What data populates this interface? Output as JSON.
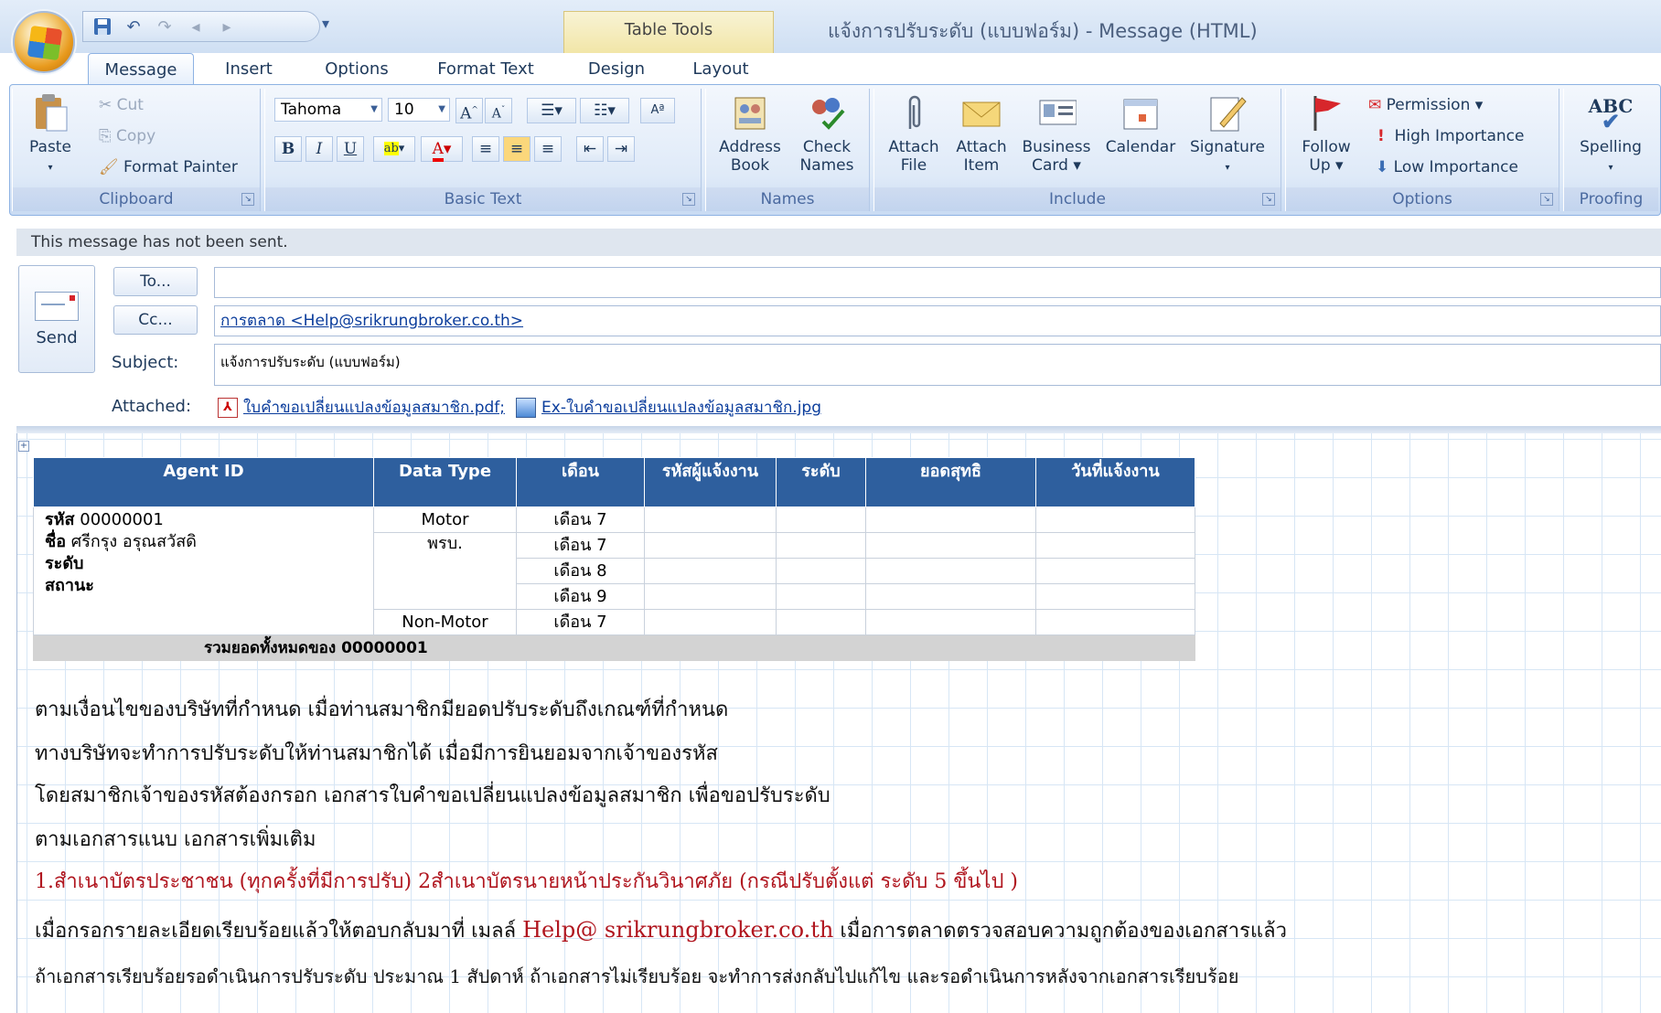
{
  "window": {
    "title": "แจ้งการปรับระดับ (แบบฟอร์ม) - Message (HTML)",
    "context_tab": "Table Tools"
  },
  "tabs": [
    "Message",
    "Insert",
    "Options",
    "Format Text",
    "Design",
    "Layout"
  ],
  "ribbon": {
    "clipboard": {
      "label": "Clipboard",
      "paste": "Paste",
      "cut": "Cut",
      "copy": "Copy",
      "format_painter": "Format Painter"
    },
    "basic_text": {
      "label": "Basic Text",
      "font": "Tahoma",
      "size": "10",
      "bold": "B",
      "italic": "I",
      "underline": "U"
    },
    "names": {
      "label": "Names",
      "address_book": [
        "Address",
        "Book"
      ],
      "check_names": [
        "Check",
        "Names"
      ]
    },
    "include": {
      "label": "Include",
      "attach_file": [
        "Attach",
        "File"
      ],
      "attach_item": [
        "Attach",
        "Item"
      ],
      "business_card": [
        "Business",
        "Card ▾"
      ],
      "calendar": "Calendar",
      "signature": "Signature"
    },
    "options": {
      "label": "Options",
      "follow_up": [
        "Follow",
        "Up ▾"
      ],
      "permission": "Permission ▾",
      "high": "High Importance",
      "low": "Low Importance"
    },
    "proofing": {
      "label": "Proofing",
      "spelling": "Spelling",
      "abc": "ABC"
    }
  },
  "message": {
    "notice": "This message has not been sent.",
    "send": "Send",
    "to_button": "To...",
    "cc_button": "Cc...",
    "to_value": "",
    "cc_value": "การตลาด <Help@srikrungbroker.co.th>",
    "subject_label": "Subject:",
    "subject_value": "แจ้งการปรับระดับ (แบบฟอร์ม)",
    "attached_label": "Attached:",
    "attachments": [
      "ใบคำขอเปลี่ยนแปลงข้อมูลสมาชิก.pdf;",
      "Ex-ใบคำขอเปลี่ยนแปลงข้อมูลสมาชิก.jpg"
    ]
  },
  "table": {
    "headers": [
      "Agent ID",
      "Data Type",
      "เดือน",
      "รหัสผู้แจ้งงาน",
      "ระดับ",
      "ยอดสุทธิ",
      "วันที่แจ้งงาน"
    ],
    "agent_lines": [
      {
        "label": "รหัส",
        "value": "00000001"
      },
      {
        "label": "ชื่อ",
        "value": "ศรีกรุง อรุณสวัสดิ"
      },
      {
        "label": "ระดับ",
        "value": ""
      },
      {
        "label": "สถานะ",
        "value": ""
      }
    ],
    "types": [
      "Motor",
      "พรบ.",
      "",
      "",
      "Non-Motor"
    ],
    "months": [
      "เดือน 7",
      "เดือน 7",
      "เดือน 8",
      "เดือน 9",
      "เดือน 7"
    ],
    "total": "รวมยอดทั้งหมดของ 00000001"
  },
  "body": {
    "p1": "ตามเงื่อนไขของบริษัทที่กำหนด  เมื่อท่านสมาชิกมียอดปรับระดับถึงเกณฑ์ที่กำหนด",
    "p2": "ทางบริษัทจะทำการปรับระดับให้ท่านสมาชิกได้ เมื่อมีการยินยอมจากเจ้าของรหัส",
    "p3": "โดยสมาชิกเจ้าของรหัสต้องกรอก  เอกสารใบคำขอเปลี่ยนแปลงข้อมูลสมาชิก เพื่อขอปรับระดับ",
    "p4": "ตามเอกสารแนบ  เอกสารเพิ่มเติม",
    "p5": "1.สำเนาบัตรประชาชน (ทุกครั้งที่มีการปรับ) 2สำเนาบัตรนายหน้าประกันวินาศภัย  (กรณีปรับตั้งแต่ ระดับ 5 ขึ้นไป )",
    "p6_a": "เมื่อกรอกรายละเอียดเรียบร้อยแล้วให้ตอบกลับมาที่ เมลล์ ",
    "p6_mail": "Help@ srikrungbroker.co.th",
    "p6_b": " เมื่อการตลาดตรวจสอบความถูกต้องของเอกสารแล้ว",
    "p7": "ถ้าเอกสารเรียบร้อยรอดำเนินการปรับระดับ ประมาณ 1 สัปดาห์ ถ้าเอกสารไม่เรียบร้อย จะทำการส่งกลับไปแก้ไข และรอดำเนินการหลังจากเอกสารเรียบร้อย"
  }
}
